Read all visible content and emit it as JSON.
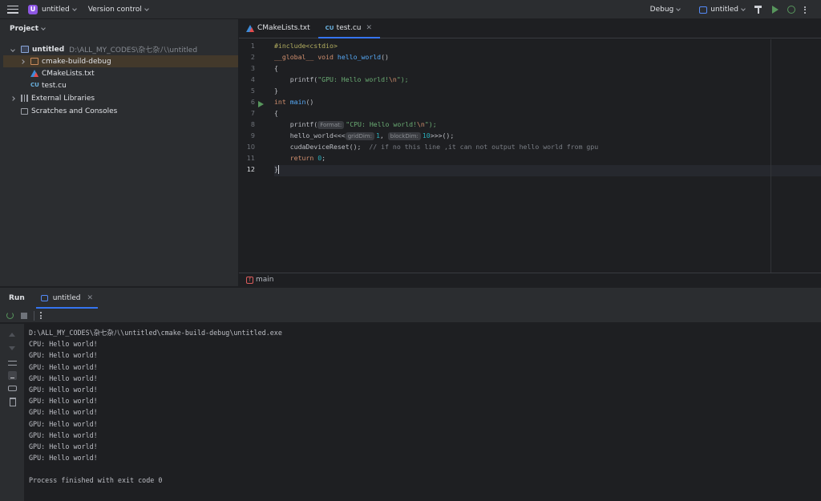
{
  "titlebar": {
    "project_badge": "U",
    "project_name": "untitled",
    "vcs": "Version control",
    "build_config": "Debug",
    "run_config": "untitled"
  },
  "project_panel": {
    "title": "Project",
    "tree": [
      {
        "label": "untitled",
        "path": "D:\\ALL_MY_CODES\\杂七杂八\\untitled",
        "icon": "module-icon",
        "expanded": true,
        "level": 0
      },
      {
        "label": "cmake-build-debug",
        "icon": "folder-icon",
        "expanded": false,
        "level": 1,
        "selected": true
      },
      {
        "label": "CMakeLists.txt",
        "icon": "cmake-icon",
        "level": 1
      },
      {
        "label": "test.cu",
        "icon": "cuda-file-icon",
        "level": 1
      },
      {
        "label": "External Libraries",
        "icon": "library-icon",
        "expanded": false,
        "level": 0
      },
      {
        "label": "Scratches and Consoles",
        "icon": "scratch-icon",
        "level": 0
      }
    ]
  },
  "editor": {
    "tabs": [
      {
        "label": "CMakeLists.txt",
        "icon": "cmake-icon",
        "active": false
      },
      {
        "label": "test.cu",
        "icon": "cuda-file-icon",
        "active": true
      }
    ],
    "line_numbers": [
      "1",
      "2",
      "3",
      "4",
      "5",
      "6",
      "7",
      "8",
      "9",
      "10",
      "11",
      "12"
    ],
    "current_line": 12,
    "code": {
      "l1": "#include<cstdio>",
      "l2_kw1": "__global__",
      "l2_kw2": "void",
      "l2_fn": "hello_world",
      "l2_rest": "()",
      "l3": "{",
      "l4_pre": "    printf(",
      "l4_str": "\"GPU: Hello world!",
      "l4_esc": "\\n",
      "l4_end": "\");",
      "l5": "}",
      "l6_kw": "int",
      "l6_fn": "main",
      "l6_rest": "()",
      "l7": "{",
      "l8_pre": "    printf(",
      "l8_hint": "Format:",
      "l8_str": "\"CPU: Hello world!",
      "l8_esc": "\\n",
      "l8_end": "\");",
      "l9_pre": "    hello_world<<<",
      "l9_hint1": "gridDim:",
      "l9_n1": "1",
      "l9_mid": ", ",
      "l9_hint2": "blockDim:",
      "l9_n2": "10",
      "l9_end": ">>>();",
      "l10_pre": "    cudaDeviceReset();  ",
      "l10_cmt": "// if no this line ,it can not output hello world from gpu",
      "l11_kw": "    return ",
      "l11_n": "0",
      "l11_end": ";",
      "l12": "}"
    },
    "breadcrumb": "main"
  },
  "run_panel": {
    "title": "Run",
    "tab_label": "untitled",
    "output": [
      "D:\\ALL_MY_CODES\\杂七杂八\\untitled\\cmake-build-debug\\untitled.exe",
      "CPU: Hello world!",
      "GPU: Hello world!",
      "GPU: Hello world!",
      "GPU: Hello world!",
      "GPU: Hello world!",
      "GPU: Hello world!",
      "GPU: Hello world!",
      "GPU: Hello world!",
      "GPU: Hello world!",
      "GPU: Hello world!",
      "GPU: Hello world!",
      "",
      "Process finished with exit code 0"
    ]
  },
  "colors": {
    "accent": "#3574f0",
    "run_green": "#57965c",
    "panel_bg": "#2b2d30",
    "editor_bg": "#1e1f22"
  }
}
